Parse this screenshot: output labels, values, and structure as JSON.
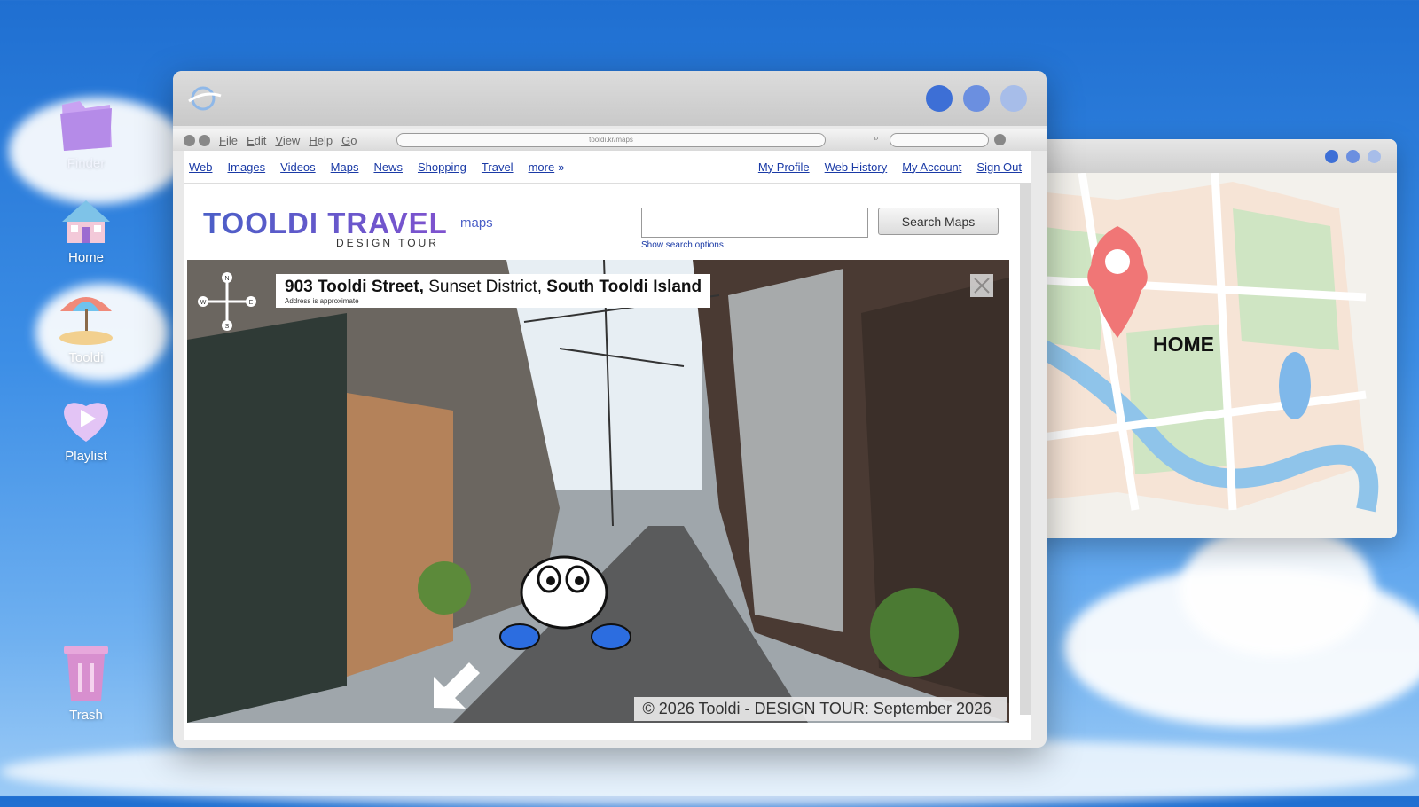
{
  "desktop": {
    "icons": [
      {
        "label": "Finder",
        "icon": "folder-icon"
      },
      {
        "label": "Home",
        "icon": "house-icon"
      },
      {
        "label": "Tooldi",
        "icon": "beach-umbrella-icon"
      },
      {
        "label": "Playlist",
        "icon": "heart-play-icon"
      },
      {
        "label": "Trash",
        "icon": "trash-icon"
      }
    ]
  },
  "map_window": {
    "label": "HOME",
    "dot_colors": [
      "#3d6fd6",
      "#6b8fe0",
      "#a7bde9"
    ]
  },
  "browser": {
    "title_dot_colors": [
      "#3d6fd6",
      "#6b8fe0",
      "#a7bde9"
    ],
    "menu": [
      "File",
      "Edit",
      "View",
      "Help",
      "Go"
    ],
    "url": "tooldi.kr/maps",
    "nav_left": [
      "Web",
      "Images",
      "Videos",
      "Maps",
      "News",
      "Shopping",
      "Travel",
      "more"
    ],
    "more_suffix": "»",
    "nav_right": [
      "My Profile",
      "Web History",
      "My Account",
      "Sign Out"
    ],
    "logo_title": "TOOLDI TRAVEL",
    "logo_sub": "DESIGN TOUR",
    "logo_maps": "maps",
    "search_value": "",
    "search_button": "Search Maps",
    "search_options": "Show search options",
    "street_view": {
      "street": "903 Tooldi Street,",
      "district": "Sunset District,",
      "island": "South Tooldi Island",
      "approx_note": "Address is approximate",
      "compass": [
        "N",
        "E",
        "S",
        "W"
      ],
      "copyright": "© 2026 Tooldi - DESIGN TOUR: September 2026"
    }
  }
}
